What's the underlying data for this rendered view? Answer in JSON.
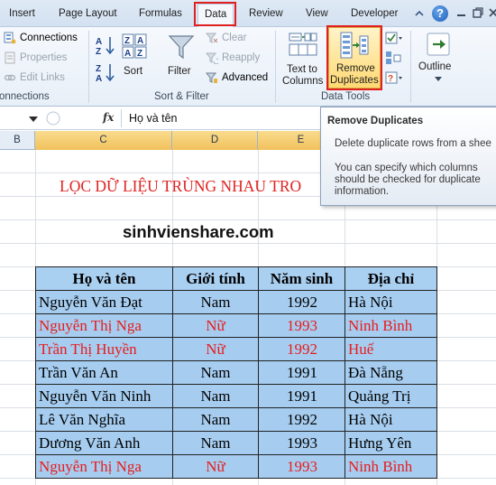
{
  "tabs": {
    "insert": "Insert",
    "page_layout": "Page Layout",
    "formulas": "Formulas",
    "data": "Data",
    "review": "Review",
    "view": "View",
    "developer": "Developer"
  },
  "help_glyph": "?",
  "ribbon": {
    "connections_group": {
      "connections": "Connections",
      "properties": "Properties",
      "edit_links": "Edit Links",
      "label": "onnections"
    },
    "sort_filter_group": {
      "sort_az_icon": "A↓Z",
      "sort_za_icon": "Z↓A",
      "sort": "Sort",
      "filter": "Filter",
      "clear": "Clear",
      "reapply": "Reapply",
      "advanced": "Advanced",
      "label": "Sort & Filter"
    },
    "data_tools_group": {
      "text_to_columns_line1": "Text to",
      "text_to_columns_line2": "Columns",
      "remove_duplicates_line1": "Remove",
      "remove_duplicates_line2": "Duplicates",
      "label": "Data Tools"
    },
    "outline": "Outline"
  },
  "formula_bar": {
    "fx": "fx",
    "value": "Họ và tên"
  },
  "columns": [
    "B",
    "C",
    "D",
    "E"
  ],
  "sheet": {
    "title": "LỌC DỮ LIỆU TRÙNG NHAU TRO",
    "watermark": "sinhvienshare.com"
  },
  "table": {
    "headers": [
      "Họ và tên",
      "Giới tính",
      "Năm sinh",
      "Địa chỉ"
    ],
    "rows": [
      {
        "name": "Nguyễn Văn Đạt",
        "gender": "Nam",
        "year": "1992",
        "address": "Hà Nội",
        "duplicate": false
      },
      {
        "name": "Nguyễn Thị Nga",
        "gender": "Nữ",
        "year": "1993",
        "address": "Ninh Bình",
        "duplicate": true
      },
      {
        "name": "Trần Thị Huyền",
        "gender": "Nữ",
        "year": "1992",
        "address": "Huế",
        "duplicate": true
      },
      {
        "name": "Trần Văn An",
        "gender": "Nam",
        "year": "1991",
        "address": "Đà Nẵng",
        "duplicate": false
      },
      {
        "name": "Nguyễn Văn Ninh",
        "gender": "Nam",
        "year": "1991",
        "address": "Quảng Trị",
        "duplicate": false
      },
      {
        "name": "Lê Văn Nghĩa",
        "gender": "Nam",
        "year": "1992",
        "address": "Hà Nội",
        "duplicate": false
      },
      {
        "name": "Dương Văn Anh",
        "gender": "Nam",
        "year": "1993",
        "address": "Hưng Yên",
        "duplicate": false
      },
      {
        "name": "Nguyễn Thị Nga",
        "gender": "Nữ",
        "year": "1993",
        "address": "Ninh Bình",
        "duplicate": true
      }
    ]
  },
  "tooltip": {
    "title": "Remove Duplicates",
    "line1": "Delete duplicate rows from a shee",
    "line2": "You can specify which columns",
    "line3": "should be checked for duplicate",
    "line4": "information."
  },
  "colors": {
    "highlight_box": "#e02020",
    "duplicate_text": "#e81c1c",
    "table_fill": "#a6cdf0",
    "selected_column": "#f1c15c"
  }
}
